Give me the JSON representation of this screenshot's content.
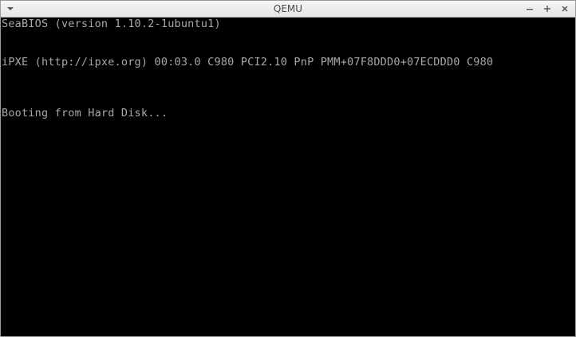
{
  "window": {
    "title": "QEMU",
    "menu_icon": "chevron-down-icon",
    "controls": {
      "minimize_icon": "minimize-icon",
      "maximize_icon": "maximize-icon",
      "close_icon": "close-icon"
    }
  },
  "console": {
    "lines": [
      "SeaBIOS (version 1.10.2-1ubuntu1)",
      "iPXE (http://ipxe.org) 00:03.0 C980 PCI2.10 PnP PMM+07F8DDD0+07ECDDD0 C980",
      "Booting from Hard Disk..."
    ],
    "text_color": "#a8a8a8",
    "background": "#000000"
  }
}
